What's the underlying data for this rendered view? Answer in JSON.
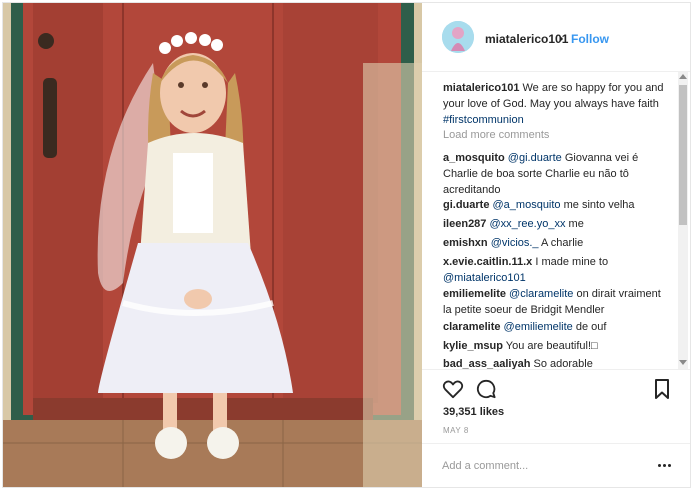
{
  "header": {
    "username": "miatalerico101",
    "dot": "•",
    "follow": "Follow"
  },
  "caption": {
    "user": "miatalerico101",
    "text": " We are so happy for you and your love of God. May you always have faith ",
    "hashtag": "#firstcommunion"
  },
  "load_more": "Load more comments",
  "comments": [
    {
      "user": "a_mosquito",
      "mention": "@gi.duarte",
      "text": " Giovanna vei é Charlie de boa sorte Charlie eu não tô acreditando"
    },
    {
      "user": "gi.duarte",
      "mention": "@a_mosquito",
      "text": " me sinto velha"
    },
    {
      "user": "ileen287",
      "mention": "@xx_ree.yo_xx",
      "text": " me"
    },
    {
      "user": "emishxn",
      "mention": "@vicios._",
      "text": " A charlie"
    },
    {
      "user": "x.evie.caitlin.11.x",
      "mention": "",
      "text": " I made mine to ",
      "mention2": "@miatalerico101"
    },
    {
      "user": "emiliemelite",
      "mention": "@claramelite",
      "text": " on dirait vraiment la petite soeur de Bridgit Mendler"
    },
    {
      "user": "claramelite",
      "mention": "@emiliemelite",
      "text": " de ouf"
    },
    {
      "user": "kylie_msup",
      "mention": "",
      "text": " You are beautiful!□"
    },
    {
      "user": "bad_ass_aaliyah",
      "mention": "",
      "text": " So adorable"
    }
  ],
  "likes": "39,351 likes",
  "date": "MAY 8",
  "add_comment": {
    "placeholder": "Add a comment..."
  },
  "icons": {
    "heart": "heart-icon",
    "comment": "comment-icon",
    "bookmark": "bookmark-icon",
    "more": "more-options-icon"
  },
  "colors": {
    "link": "#3897f0",
    "mention": "#003569",
    "text": "#262626",
    "muted": "#999999"
  }
}
